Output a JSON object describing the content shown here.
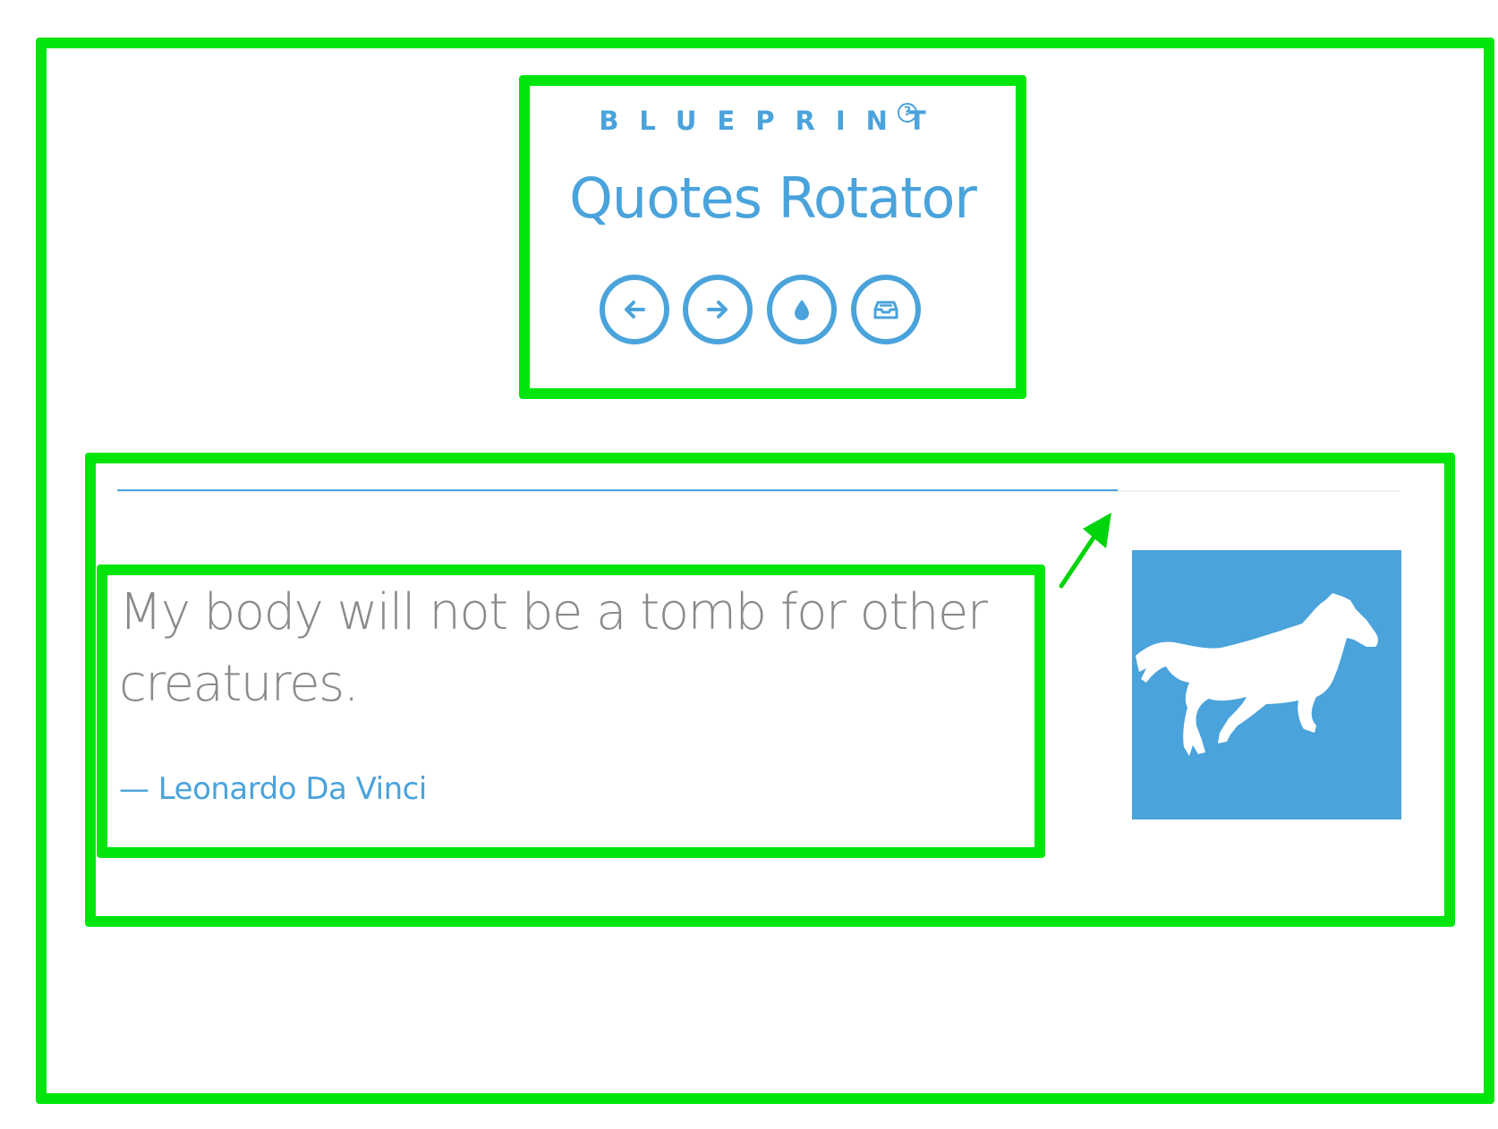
{
  "header": {
    "brand": "BLUEPRINT",
    "help_icon": "question-circle-icon",
    "title": "Quotes Rotator"
  },
  "controls": {
    "buttons": [
      {
        "icon": "arrow-left-icon",
        "action": "previous"
      },
      {
        "icon": "arrow-right-icon",
        "action": "next"
      },
      {
        "icon": "water-drop-icon",
        "action": "color"
      },
      {
        "icon": "archive-tray-icon",
        "action": "archive"
      }
    ]
  },
  "quote": {
    "text": "My body will not be a tomb for other creatures.",
    "author": "— Leonardo Da Vinci",
    "image_icon": "running-horse-icon",
    "progress": 0.78
  },
  "colors": {
    "accent": "#4aa3db",
    "quote_text": "#8a8a8a",
    "annotation": "#00e60c",
    "divider": "#eeeeee"
  }
}
